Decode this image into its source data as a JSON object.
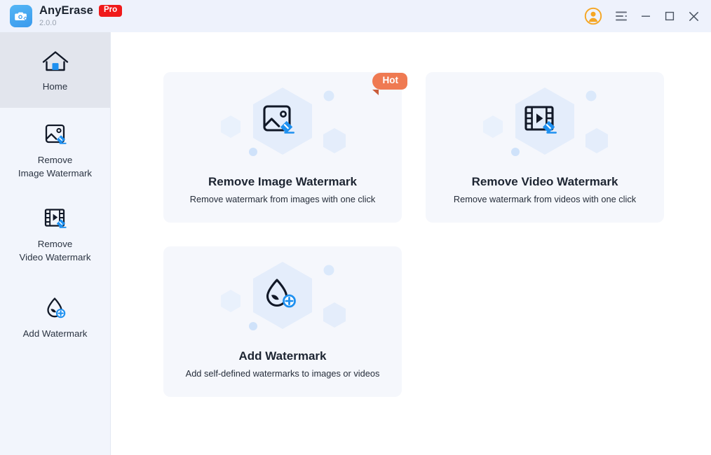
{
  "window": {
    "app_name": "AnyErase",
    "pro_badge": "Pro",
    "version": "2.0.0",
    "logo_icon": "camera-eraser-icon",
    "controls": {
      "account": "account-avatar-icon",
      "menu": "hamburger-menu-icon",
      "minimize": "minimize-icon",
      "maximize": "maximize-icon",
      "close": "close-icon"
    }
  },
  "colors": {
    "titlebar_bg": "#eef2fc",
    "sidebar_bg": "#f2f5fc",
    "sidebar_active_bg": "#e2e5ed",
    "card_bg": "#f5f7fc",
    "accent_blue": "#1e90f0",
    "hot_orange": "#ef7a52",
    "pro_red": "#f01a1a",
    "hex_decor": "#e4edfb",
    "text_dark": "#1d2532"
  },
  "sidebar": {
    "items": [
      {
        "id": "home",
        "label": "Home",
        "icon": "home-icon",
        "active": true
      },
      {
        "id": "remove-image-watermark",
        "label": "Remove\nImage Watermark",
        "icon": "image-eraser-icon",
        "active": false
      },
      {
        "id": "remove-video-watermark",
        "label": "Remove\nVideo Watermark",
        "icon": "video-eraser-icon",
        "active": false
      },
      {
        "id": "add-watermark",
        "label": "Add Watermark",
        "icon": "droplet-plus-icon",
        "active": false
      }
    ]
  },
  "main": {
    "cards": [
      {
        "id": "remove-image-watermark",
        "title": "Remove Image Watermark",
        "subtitle": "Remove watermark from images with one click",
        "icon": "image-eraser-icon",
        "badge": "Hot"
      },
      {
        "id": "remove-video-watermark",
        "title": "Remove Video Watermark",
        "subtitle": "Remove watermark from videos with one click",
        "icon": "video-eraser-icon",
        "badge": null
      },
      {
        "id": "add-watermark",
        "title": "Add Watermark",
        "subtitle": "Add self-defined watermarks to images or videos",
        "icon": "droplet-plus-icon",
        "badge": null
      }
    ]
  }
}
